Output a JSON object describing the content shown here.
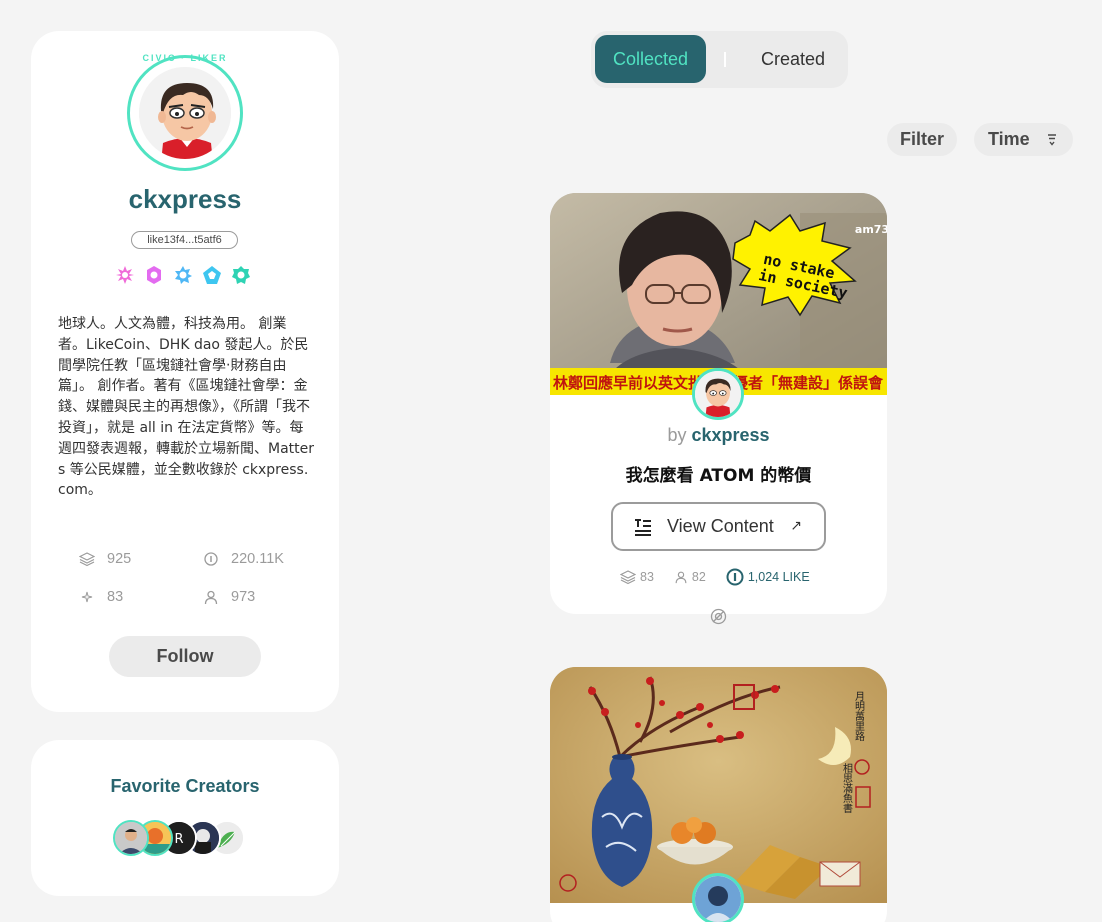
{
  "profile": {
    "civic_label": "CIVIC · LIKER",
    "display_name": "ckxpress",
    "wallet": "like13f4...t5atf6",
    "bio": "地球人。人文為體，科技為用。 創業者。LikeCoin、DHK dao 發起人。於民間學院任教「區塊鏈社會學‧財務自由篇」。 創作者。著有《區塊鏈社會學：金錢、媒體與民主的再想像》，《所謂「我不投資」，就是 all in 在法定貨幣》等。每週四發表週報，轉載於立場新聞、Matters 等公民媒體，並全數收錄於 ckxpress.com。",
    "stats": {
      "collected": "925",
      "value": "220.11K",
      "created": "83",
      "collectors": "973"
    },
    "follow_label": "Follow",
    "badge_colors": [
      "#f06bd8",
      "#e36bf0",
      "#4fb7f5",
      "#3ec6f0",
      "#2fd3b4"
    ]
  },
  "favorite_creators": {
    "title": "Favorite Creators",
    "count": 5
  },
  "tabs": {
    "collected": "Collected",
    "created": "Created"
  },
  "filters": {
    "filter_label": "Filter",
    "sort_label": "Time"
  },
  "cards": [
    {
      "by_prefix": "by",
      "creator": "ckxpress",
      "title": "我怎麼看 ATOM 的幣價",
      "view_label": "View Content",
      "stats": {
        "collected": "83",
        "collectors": "82",
        "like": "1,024 LIKE"
      },
      "image": {
        "speech_bubble": "no stake in society",
        "watermark": "am73",
        "caption": "林鄭回應早前以英文批評滋擾者「無建設」係誤會"
      }
    },
    {
      "image": {
        "calligraphy_1": "月明萬里路",
        "calligraphy_2": "相思滿魚書"
      }
    }
  ],
  "colors": {
    "brand": "#28646e",
    "accent": "#50e3c2",
    "background": "#f4f4f4"
  }
}
